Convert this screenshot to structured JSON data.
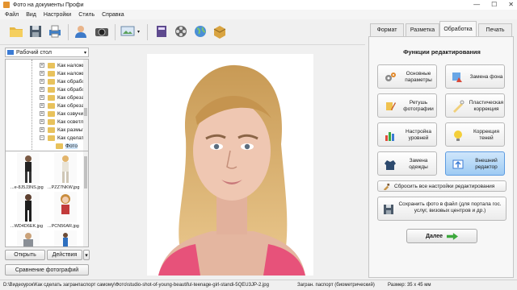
{
  "window": {
    "title": "Фото на документы Профи",
    "controls": [
      "—",
      "☐",
      "✕"
    ]
  },
  "menu": [
    "Файл",
    "Вид",
    "Настройки",
    "Стиль",
    "Справка"
  ],
  "toolbar": {
    "icons": [
      "open-folder-icon",
      "save-icon",
      "print-icon",
      "contacts-icon",
      "camera-icon",
      "screen-icon",
      "book-icon",
      "film-icon",
      "world-icon",
      "box-icon"
    ]
  },
  "left": {
    "drive": "Рабочий стол",
    "tree": [
      {
        "label": "Как наложи",
        "expand": "+"
      },
      {
        "label": "Как наложи",
        "expand": "+"
      },
      {
        "label": "Как обработ",
        "expand": "+"
      },
      {
        "label": "Как обработ",
        "expand": "+"
      },
      {
        "label": "Как обрезат",
        "expand": "+"
      },
      {
        "label": "Как обрезат",
        "expand": "+"
      },
      {
        "label": "Как озвучит",
        "expand": "+"
      },
      {
        "label": "Как осветли",
        "expand": "+"
      },
      {
        "label": "Как размыть",
        "expand": "+"
      },
      {
        "label": "Как сделать",
        "expand": "−"
      },
      {
        "label": "Фото",
        "expand": ""
      }
    ],
    "thumbnails": [
      {
        "caption": "...e-8J5J3NS.jpg"
      },
      {
        "caption": "...PZZ7NKW.jpg"
      },
      {
        "caption": "...WD4D6EK.jpg"
      },
      {
        "caption": "...PCN56AR.jpg"
      },
      {
        "caption": ""
      },
      {
        "caption": ""
      }
    ],
    "open_button": "Открыть",
    "actions_button": "Действия",
    "compare_button": "Сравнение фотографий"
  },
  "right": {
    "tabs": [
      "Формат",
      "Разметка",
      "Обработка",
      "Печать"
    ],
    "active_tab": "Обработка",
    "heading": "Функции редактирования",
    "functions": [
      {
        "label": "Основные параметры",
        "icon": "gears-icon"
      },
      {
        "label": "Замена фона",
        "icon": "background-replace-icon"
      },
      {
        "label": "Ретушь фотографии",
        "icon": "retouch-icon"
      },
      {
        "label": "Пластическая коррекция",
        "icon": "plastic-correction-icon"
      },
      {
        "label": "Настройка уровней",
        "icon": "levels-icon"
      },
      {
        "label": "Коррекция теней",
        "icon": "shadows-icon"
      },
      {
        "label": "Замена одежды",
        "icon": "clothes-icon"
      },
      {
        "label": "Внешний редактор",
        "icon": "external-editor-icon"
      }
    ],
    "reset": "Сбросить все настройки редактирования",
    "save": "Сохранить фото в файл (для портала гос. услуг, визовых центров и др.)",
    "next": "Далее"
  },
  "status": {
    "path": "D:\\Видеоурок\\Как сделать загранпаспорт самому\\Фото\\studio-shot-of-young-beautiful-teenage-girl-standi-5QEU3JP-2.jpg",
    "doc": "Загран. паспорт (биометрический)",
    "size": "Размер: 35 x 45 мм"
  },
  "colors": {
    "accent": "#3b7bd4",
    "selected_tab": "#f7f7f7",
    "next_arrow": "#3ca83c"
  }
}
